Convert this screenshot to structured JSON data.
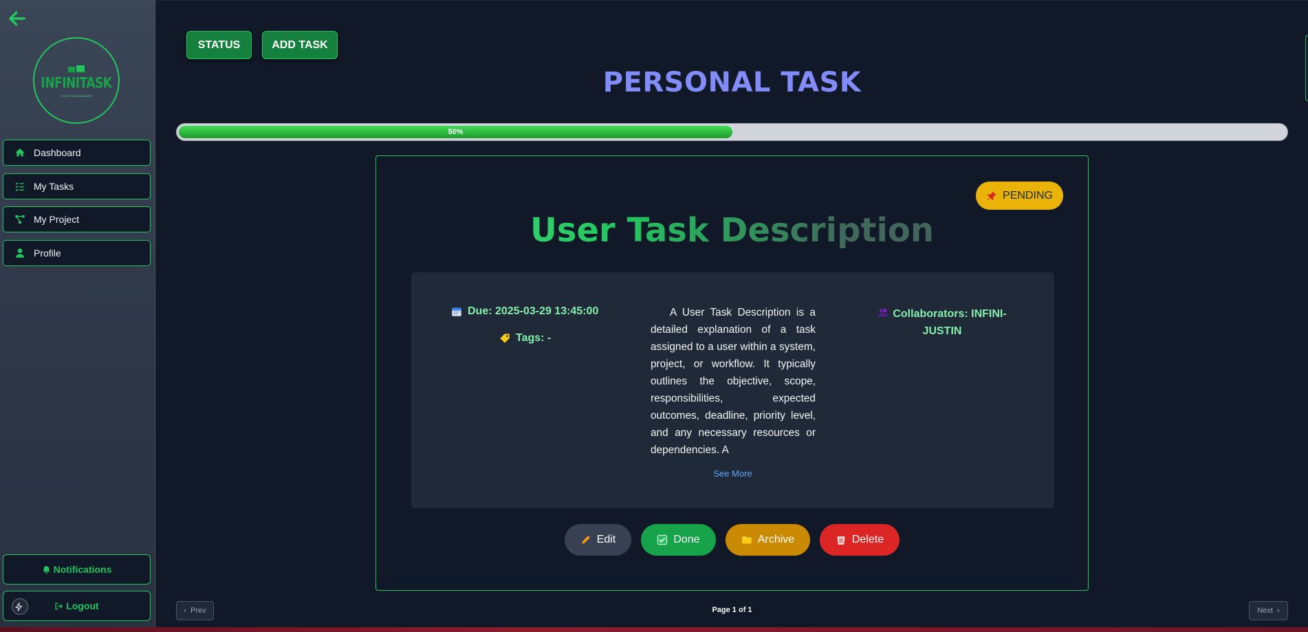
{
  "sidebar": {
    "logo_text": "INFINITASK",
    "logo_sub": "YOUR TASK MANAGER",
    "items": [
      {
        "label": "Dashboard",
        "icon": "home-icon"
      },
      {
        "label": "My Tasks",
        "icon": "list-check-icon"
      },
      {
        "label": "My Project",
        "icon": "project-diagram-icon"
      },
      {
        "label": "Profile",
        "icon": "user-icon"
      }
    ],
    "notifications_label": "Notifications",
    "logout_label": "Logout"
  },
  "toolbar": {
    "status_label": "STATUS",
    "add_task_label": "ADD TASK"
  },
  "page": {
    "title": "PERSONAL TASK",
    "progress": 0.5,
    "progress_label": "50%"
  },
  "task": {
    "status": "PENDING",
    "title": "User Task Description",
    "due": "Due: 2025-03-29 13:45:00",
    "tags": "Tags: -",
    "description": "A User Task Description is a detailed explanation of a task assigned to a user within a system, project, or workflow. It typically outlines the objective, scope, responsibilities, expected outcomes, deadline, priority level, and any necessary resources or dependencies. A",
    "see_more": "See More",
    "collaborators": "Collaborators: INFINI-JUSTIN"
  },
  "actions": {
    "edit": "Edit",
    "done": "Done",
    "archive": "Archive",
    "delete": "Delete"
  },
  "pagination": {
    "prev": "Prev",
    "page_info": "Page 1 of 1",
    "next": "Next"
  },
  "colors": {
    "accent": "#22c55e",
    "title": "#818cf8",
    "pending": "#eab308",
    "done": "#16a34a",
    "archive": "#ca8a04",
    "delete": "#dc2626"
  }
}
